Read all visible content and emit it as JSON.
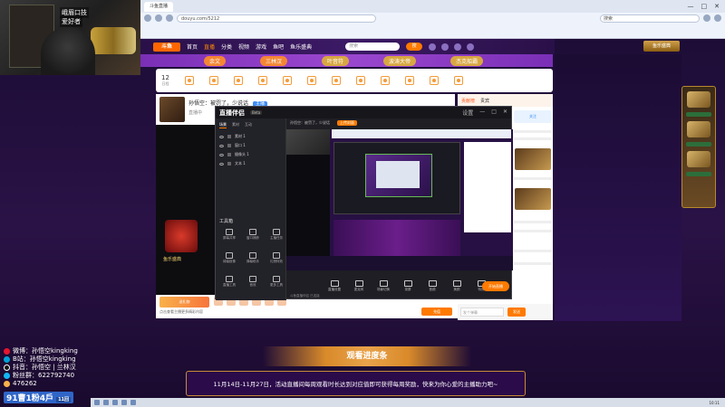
{
  "webcam": {
    "overlay_line1": "峨眉口技",
    "overlay_line2": "爱好者"
  },
  "browser": {
    "tab_title": "斗鱼直播",
    "address": "douyu.com/5212",
    "search_placeholder": "搜索",
    "win_controls": [
      "—",
      "□",
      "✕"
    ]
  },
  "site": {
    "logo": "斗鱼",
    "nav": [
      "首页",
      "直播",
      "分类",
      "视频",
      "游戏",
      "鱼吧",
      "鱼乐盛典"
    ],
    "search_placeholder": "搜索",
    "search_btn": "搜",
    "promo_btn": "鱼乐盛典",
    "banner_chips": [
      "余文",
      "三林汉",
      "叶音符",
      "波涛大帝",
      "杰克船霸"
    ],
    "date_day": "12",
    "date_label": "日程"
  },
  "room": {
    "title": "孙悟空：被罚了，少说话",
    "tag": "主播",
    "meta": "直播中"
  },
  "right_panel": {
    "tabs": [
      "贡献榜",
      "贵宾"
    ],
    "card_label": "关注",
    "input_placeholder": "发个弹幕",
    "send": "发送"
  },
  "player": {
    "promo_text": "鱼乐盛典"
  },
  "bottombar": {
    "gift_label": "送礼物",
    "text": "点击查看主播更多精彩内容",
    "btn": "充值"
  },
  "obs": {
    "brand": "直播伴侣",
    "beta": "Beta",
    "title_right": [
      "设置",
      "—",
      "□",
      "✕"
    ],
    "left_tabs": [
      "场景",
      "素材",
      "互动"
    ],
    "scenes": [
      "素材 1",
      "窗口 1",
      "摄像头 1",
      "文本 1"
    ],
    "tools_header": "工具箱",
    "tools": [
      "屏幕共享",
      "窗口捕获",
      "主播任务",
      "绿幕抠像",
      "弹幕助手",
      "礼物特效",
      "直播工具",
      "音效",
      "更多工具"
    ],
    "sub_items": [
      "孙悟空：被罚了，少说话",
      "上传封面"
    ],
    "controls": [
      "直播设置",
      "麦克风",
      "场景切换",
      "录屏",
      "音频",
      "美颜",
      "特效"
    ],
    "go_live": "开始直播",
    "footer": "斗鱼直播伴侣 已连接"
  },
  "stream": {
    "progress_title": "观看进度条",
    "notice": "11月14日-11月27日，活动直播间每周观看时长达到对应值即可获得每周奖励，快来为你心爱的主播助力吧~"
  },
  "social": {
    "rows": [
      {
        "icon": "weibo-icon",
        "text": "微博：孙悟空kingking",
        "color": "#e6162d"
      },
      {
        "icon": "bilibili-icon",
        "text": "B站：孙悟空kingking",
        "color": "#00a1d6"
      },
      {
        "icon": "douyin-icon",
        "text": "抖音：孙悟空 | 兰林汉",
        "color": "#111111"
      },
      {
        "icon": "qq-icon",
        "text": "粉丝群：622792740",
        "color": "#12b7f5"
      },
      {
        "icon": "group-icon",
        "text": "476262",
        "color": "#f9b24b"
      }
    ],
    "counter": "91曹1粉4戶",
    "counter_sub": "11回"
  },
  "taskbar": {
    "clock": "10:11"
  }
}
